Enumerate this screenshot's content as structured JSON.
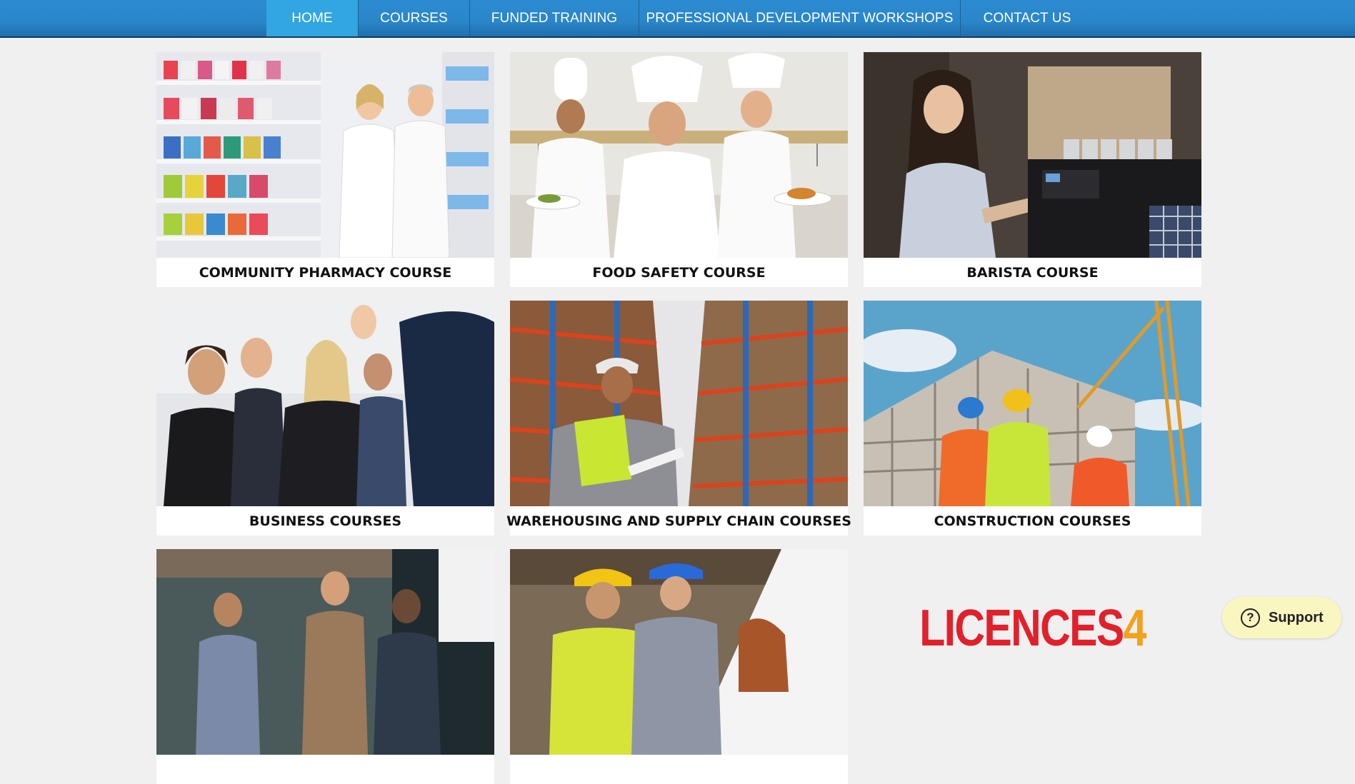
{
  "nav": {
    "items": [
      {
        "label": "HOME",
        "active": true
      },
      {
        "label": "COURSES",
        "active": false
      },
      {
        "label": "FUNDED TRAINING",
        "active": false
      },
      {
        "label": "PROFESSIONAL DEVELOPMENT WORKSHOPS",
        "active": false
      },
      {
        "label": "CONTACT US",
        "active": false
      }
    ]
  },
  "courses": [
    {
      "title": "COMMUNITY PHARMACY COURSE",
      "image": "pharmacists in pharmacy aisle"
    },
    {
      "title": "FOOD SAFETY COURSE",
      "image": "three chefs presenting dishes"
    },
    {
      "title": "BARISTA COURSE",
      "image": "barista at espresso machine"
    },
    {
      "title": "BUSINESS COURSES",
      "image": "business people in seminar"
    },
    {
      "title": "WAREHOUSING AND SUPPLY CHAIN COURSES",
      "image": "worker with clipboard in warehouse aisle"
    },
    {
      "title": "CONSTRUCTION COURSES",
      "image": "builders at construction site with crane"
    },
    {
      "title": "",
      "image": "team meeting in office"
    },
    {
      "title": "",
      "image": "workers in hard hats"
    }
  ],
  "logo": {
    "text": "LICENCES",
    "number": "4"
  },
  "support": {
    "label": "Support",
    "icon": "question-icon",
    "icon_glyph": "?"
  },
  "colors": {
    "nav_bg": "#2a86c9",
    "nav_active": "#31a6e0",
    "logo_red": "#e0212b",
    "logo_orange": "#f2a21c",
    "support_bg": "#faf6c0"
  }
}
